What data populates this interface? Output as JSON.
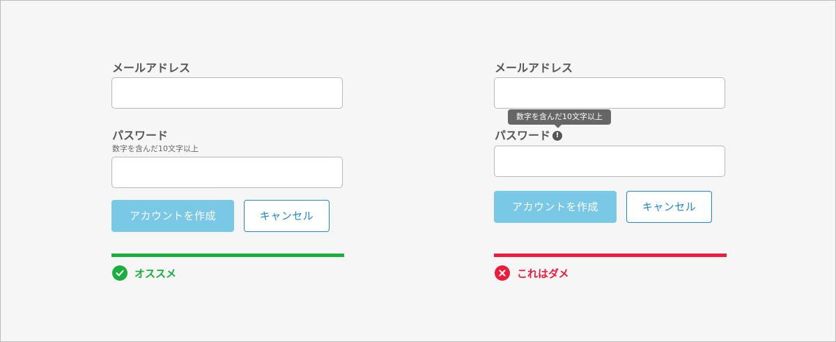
{
  "good": {
    "email_label": "メールアドレス",
    "password_label": "パスワード",
    "password_hint": "数字を含んだ10文字以上",
    "create_button": "アカウントを作成",
    "cancel_button": "キャンセル",
    "verdict_text": "オススメ",
    "verdict_icon": "check-circle-icon",
    "accent_color": "#1aae3d"
  },
  "bad": {
    "email_label": "メールアドレス",
    "password_label": "パスワード",
    "tooltip_text": "数字を含んだ10文字以上",
    "info_icon_glyph": "!",
    "info_icon": "info-icon",
    "create_button": "アカウントを作成",
    "cancel_button": "キャンセル",
    "verdict_text": "これはダメ",
    "verdict_icon": "cross-circle-icon",
    "accent_color": "#ee1b3a"
  },
  "colors": {
    "primary_button": "#79c8e6",
    "secondary_button": "#1f86d4",
    "background": "#f6f6f6"
  }
}
